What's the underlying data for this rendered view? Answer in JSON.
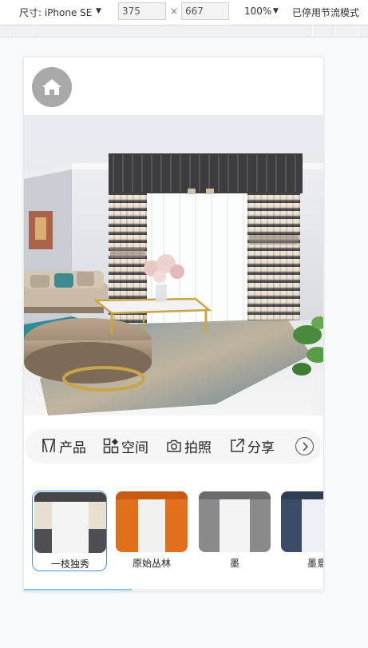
{
  "devtools": {
    "size_label": "尺寸: iPhone SE",
    "width": "375",
    "times": "×",
    "height": "667",
    "zoom": "100%",
    "throttle": "已停用节流模式"
  },
  "app": {
    "actions": [
      {
        "label": "产品",
        "icon": "curtain-icon"
      },
      {
        "label": "空间",
        "icon": "grid-icon"
      },
      {
        "label": "拍照",
        "icon": "camera-icon"
      },
      {
        "label": "分享",
        "icon": "share-icon"
      }
    ],
    "more_icon": "chevron-right-circle-icon",
    "thumbnails": [
      {
        "name": "一枝独秀",
        "selected": true
      },
      {
        "name": "原始丛林",
        "selected": false
      },
      {
        "name": "墨",
        "selected": false
      },
      {
        "name": "墨意",
        "selected": false
      }
    ],
    "scroll_progress": 0.36
  },
  "colors": {
    "accent": "#4a90e2",
    "progress": "#7ec8ef",
    "home_button": "#a9a9a9"
  }
}
